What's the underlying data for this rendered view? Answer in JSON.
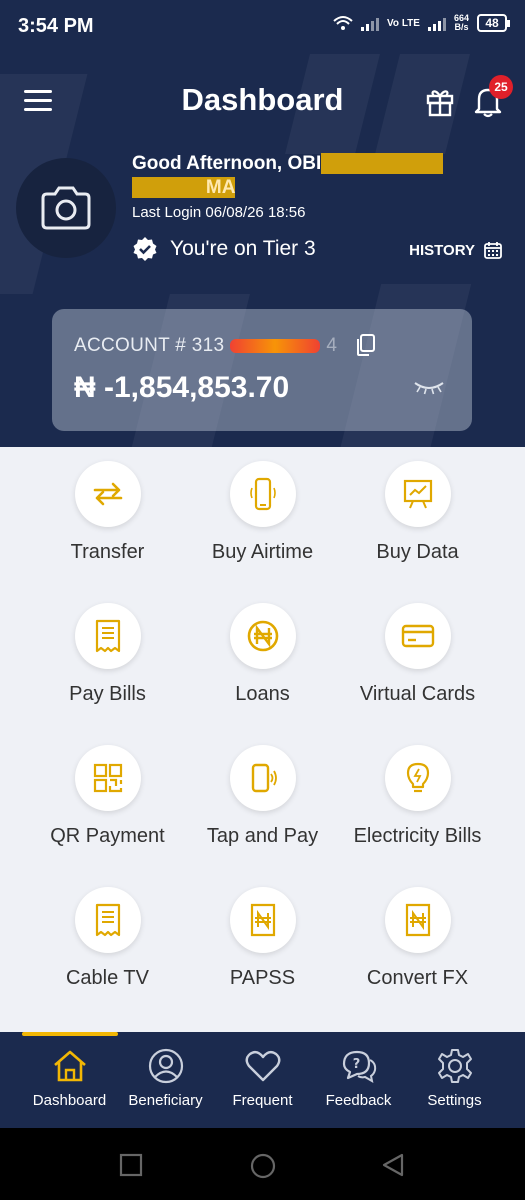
{
  "status_bar": {
    "time": "3:54 PM",
    "network": "Vo LTE",
    "speed_top": "664",
    "speed_bottom": "B/s",
    "battery": "48"
  },
  "header": {
    "title": "Dashboard",
    "notification_count": "25"
  },
  "profile": {
    "greeting": "Good Afternoon, OBI",
    "name_line2": "MA",
    "last_login": "Last Login 06/08/26 18:56",
    "tier": "You're on Tier 3",
    "history_label": "HISTORY"
  },
  "account": {
    "label": "ACCOUNT # 313",
    "suffix": "4",
    "balance": "₦ -1,854,853.70"
  },
  "services": [
    {
      "label": "Transfer",
      "icon": "transfer-icon"
    },
    {
      "label": "Buy Airtime",
      "icon": "phone-icon"
    },
    {
      "label": "Buy Data",
      "icon": "data-icon"
    },
    {
      "label": "Pay Bills",
      "icon": "bill-icon"
    },
    {
      "label": "Loans",
      "icon": "naira-coin-icon"
    },
    {
      "label": "Virtual Cards",
      "icon": "card-icon"
    },
    {
      "label": "QR Payment",
      "icon": "qr-icon"
    },
    {
      "label": "Tap and Pay",
      "icon": "tap-icon"
    },
    {
      "label": "Electricity Bills",
      "icon": "bulb-icon"
    },
    {
      "label": "Cable TV",
      "icon": "bill-icon"
    },
    {
      "label": "PAPSS",
      "icon": "naira-doc-icon"
    },
    {
      "label": "Convert FX",
      "icon": "naira-doc-icon"
    }
  ],
  "nav": [
    {
      "label": "Dashboard",
      "icon": "home-icon"
    },
    {
      "label": "Beneficiary",
      "icon": "user-icon"
    },
    {
      "label": "Frequent",
      "icon": "heart-icon"
    },
    {
      "label": "Feedback",
      "icon": "feedback-icon"
    },
    {
      "label": "Settings",
      "icon": "gear-icon"
    }
  ],
  "colors": {
    "navy": "#1b2a4e",
    "accent": "#f2b705",
    "icon_gold": "#e0a800",
    "badge": "#e0202a"
  }
}
